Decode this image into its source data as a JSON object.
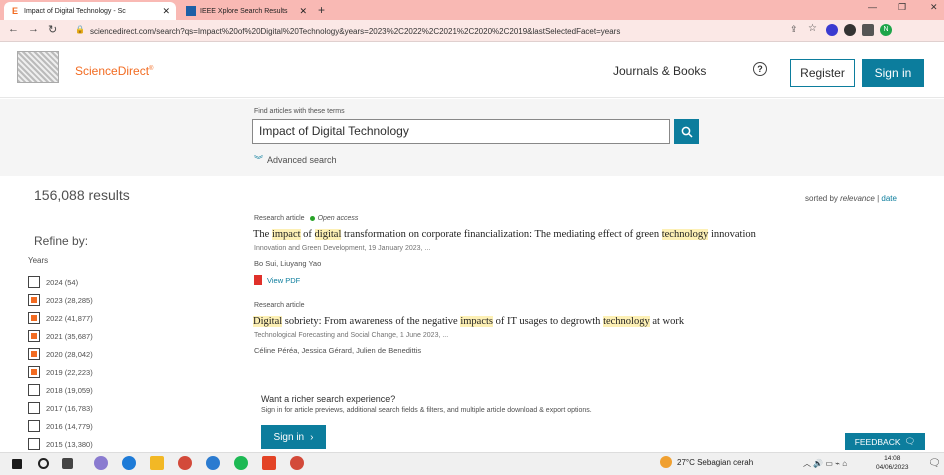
{
  "browser": {
    "tabs": [
      {
        "label": "Impact of Digital Technology - Sc",
        "favicon": "E",
        "close": "✕"
      },
      {
        "label": "IEEE Xplore Search Results",
        "close": "✕"
      }
    ],
    "new_tab": "+",
    "url": "sciencedirect.com/search?qs=Impact%20of%20Digital%20Technology&years=2023%2C2022%2C2021%2C2020%2C2019&lastSelectedFacet=years",
    "profile_initial": "N"
  },
  "header": {
    "brand": "ScienceDirect",
    "brand_sup": "®",
    "journals_books": "Journals & Books",
    "help": "?",
    "register": "Register",
    "signin": "Sign in"
  },
  "search": {
    "label": "Find articles with these terms",
    "query": "Impact of Digital Technology",
    "advanced": "Advanced search"
  },
  "results": {
    "count": "156,088 results",
    "sorted_by": "sorted by",
    "relevance": "relevance",
    "sep": "|",
    "date": "date",
    "items": [
      {
        "type": "Research article",
        "open_access": "Open access",
        "title_parts": [
          {
            "t": "The "
          },
          {
            "t": "impact",
            "h": true
          },
          {
            "t": " of "
          },
          {
            "t": "digital",
            "h": true
          },
          {
            "t": " transformation on corporate financialization: The mediating effect of green "
          },
          {
            "t": "technology",
            "h": true
          },
          {
            "t": " innovation"
          }
        ],
        "source": "Innovation and Green Development, 19 January 2023, ...",
        "authors": "Bo Sui, Liuyang Yao",
        "view_pdf": "View PDF"
      },
      {
        "type": "Research article",
        "title_parts": [
          {
            "t": "Digital",
            "h": true
          },
          {
            "t": " sobriety: From awareness of the negative "
          },
          {
            "t": "impacts",
            "h": true
          },
          {
            "t": " of IT usages to degrowth "
          },
          {
            "t": "technology",
            "h": true
          },
          {
            "t": " at work"
          }
        ],
        "source": "Technological Forecasting and Social Change, 1 June 2023, ...",
        "authors": "Céline Péréa, Jessica Gérard, Julien de Benedittis"
      }
    ]
  },
  "refine": {
    "title": "Refine by:",
    "years_label": "Years",
    "years": [
      {
        "label": "2024 (54)",
        "checked": false
      },
      {
        "label": "2023 (28,285)",
        "checked": true
      },
      {
        "label": "2022 (41,877)",
        "checked": true
      },
      {
        "label": "2021 (35,687)",
        "checked": true
      },
      {
        "label": "2020 (28,042)",
        "checked": true
      },
      {
        "label": "2019 (22,223)",
        "checked": true
      },
      {
        "label": "2018 (19,059)",
        "checked": false
      },
      {
        "label": "2017 (16,783)",
        "checked": false
      },
      {
        "label": "2016 (14,779)",
        "checked": false
      },
      {
        "label": "2015 (13,380)",
        "checked": false
      }
    ]
  },
  "promo": {
    "title": "Want a richer search experience?",
    "subtitle": "Sign in for article previews, additional search fields & filters, and multiple article download & export options.",
    "signin": "Sign in",
    "arrow": "›"
  },
  "feedback": "FEEDBACK",
  "taskbar": {
    "weather": "27°C  Sebagian cerah",
    "time": "14:08",
    "date": "04/06/2023"
  },
  "colors": {
    "accent": "#0c7d9d",
    "brand": "#f26b21",
    "highlight": "#fdf0b5",
    "tabbar": "#f9b9b4"
  }
}
